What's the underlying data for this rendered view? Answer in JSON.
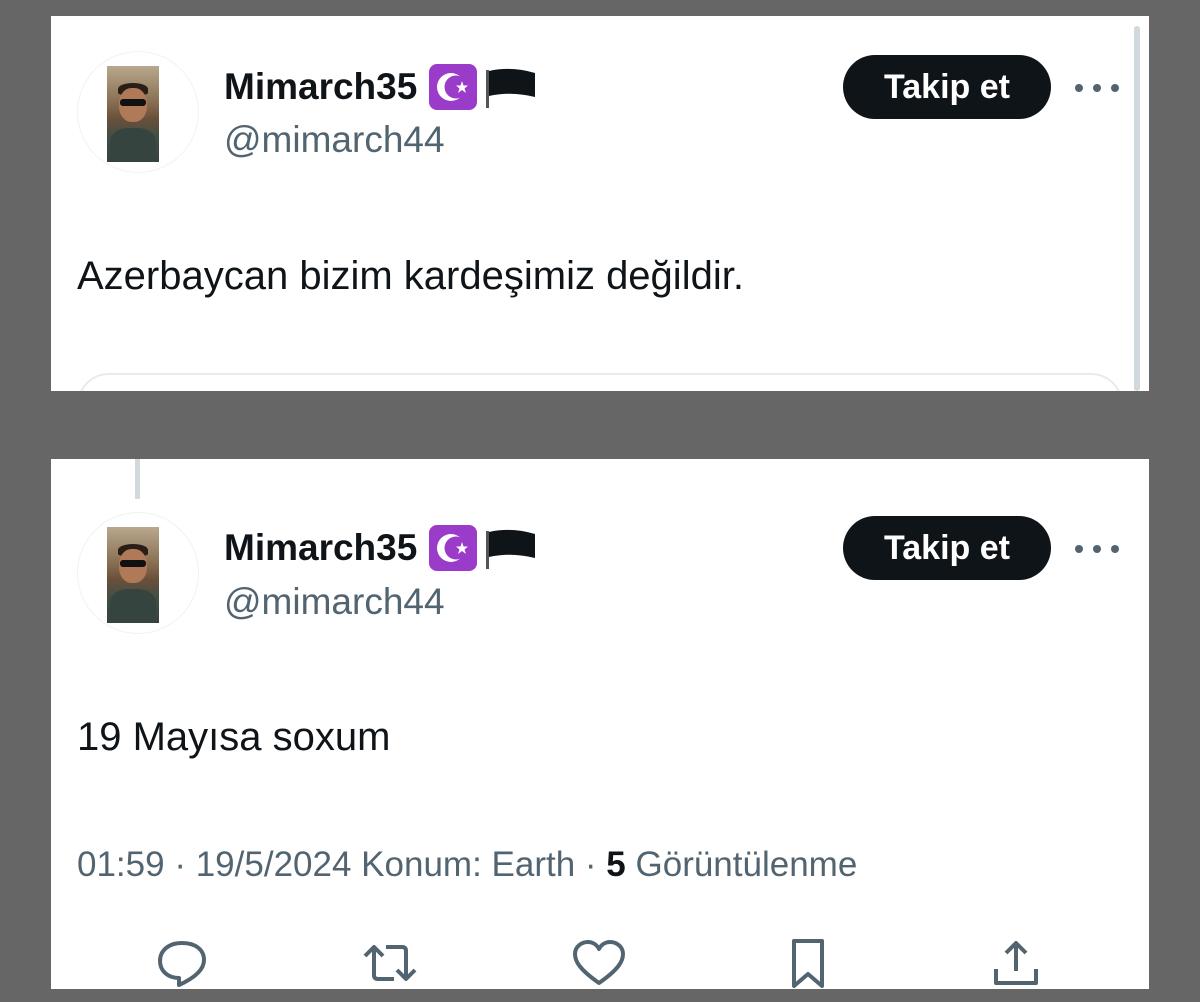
{
  "tweets": [
    {
      "display_name": "Mimarch35",
      "handle": "@mimarch44",
      "follow_label": "Takip et",
      "text": "Azerbaycan bizim kardeşimiz değildir."
    },
    {
      "display_name": "Mimarch35",
      "handle": "@mimarch44",
      "follow_label": "Takip et",
      "text": "19 Mayısa soxum",
      "time": "01:59",
      "date": "19/5/2024",
      "location": "Konum: Earth",
      "views_count": "5",
      "views_label": "Görüntülenme"
    }
  ],
  "separator": "·",
  "colors": {
    "background": "#666666",
    "text_primary": "#0f1419",
    "text_secondary": "#536471",
    "badge_purple": "#9b3bc9"
  },
  "icons": [
    "star-and-crescent-icon",
    "black-flag-icon",
    "more-icon",
    "reply-icon",
    "retweet-icon",
    "like-icon",
    "bookmark-icon",
    "share-icon"
  ]
}
